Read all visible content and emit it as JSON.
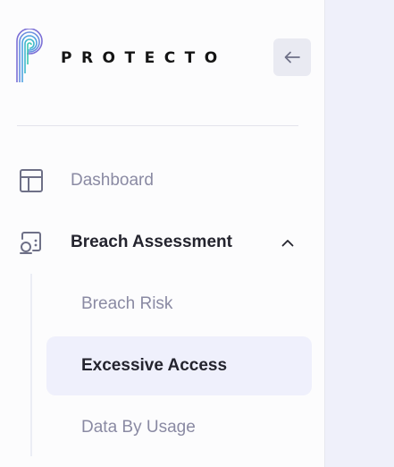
{
  "brand": {
    "name": "PROTECTO",
    "logo_icon": "fingerprint-p-logo",
    "accent_colors": [
      "#7b6fd6",
      "#4fa3e0",
      "#3cc8b4"
    ]
  },
  "header": {
    "collapse_icon": "arrow-left-icon"
  },
  "nav": {
    "dashboard": {
      "label": "Dashboard",
      "icon": "layout-grid-icon"
    },
    "breach_assessment": {
      "label": "Breach Assessment",
      "icon": "shield-scan-icon",
      "expanded": true,
      "chevron": "chevron-up-icon",
      "children": [
        {
          "label": "Breach Risk",
          "selected": false
        },
        {
          "label": "Excessive Access",
          "selected": true
        },
        {
          "label": "Data By Usage",
          "selected": false
        }
      ]
    }
  },
  "colors": {
    "sidebar_bg": "#fcfcfd",
    "main_bg": "#eff0fa",
    "selected_bg": "#eff0fc",
    "active_text": "#24242e",
    "muted_text": "#8a8aa3"
  }
}
